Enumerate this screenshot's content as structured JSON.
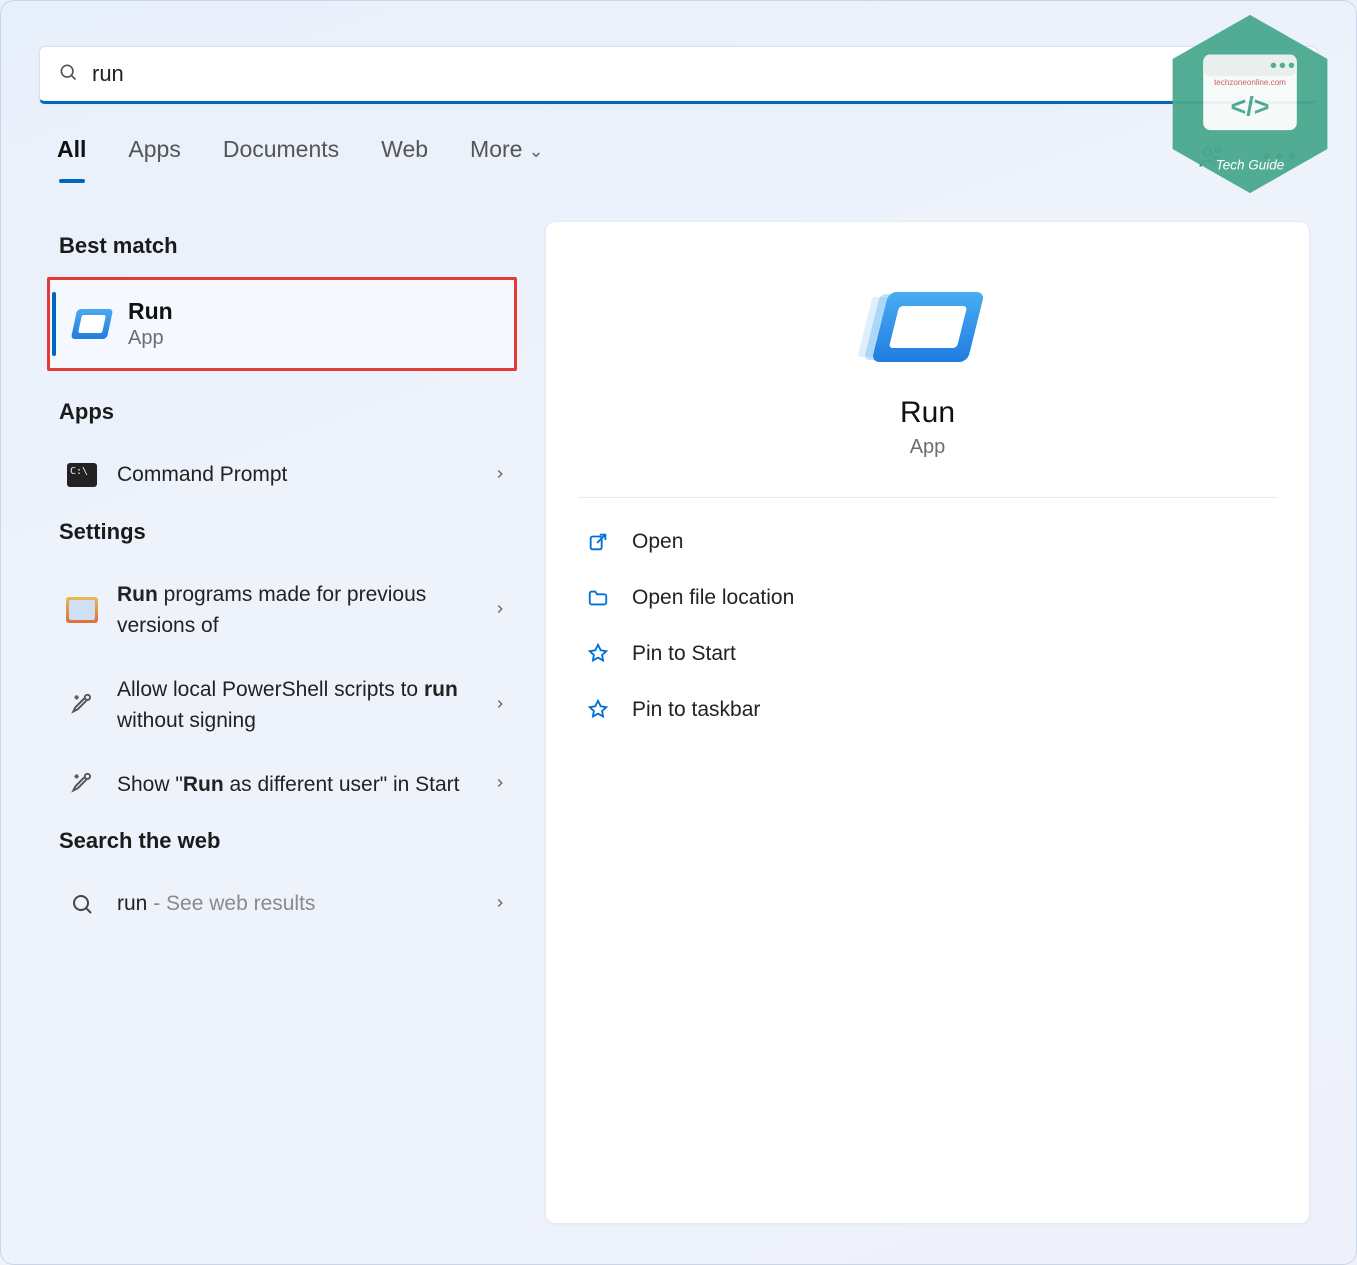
{
  "search": {
    "query": "run"
  },
  "tabs": {
    "items": [
      "All",
      "Apps",
      "Documents",
      "Web",
      "More"
    ],
    "active": 0
  },
  "left": {
    "best_match_heading": "Best match",
    "best_match": {
      "title": "Run",
      "subtitle": "App"
    },
    "apps_heading": "Apps",
    "apps": [
      {
        "label": "Command Prompt"
      }
    ],
    "settings_heading": "Settings",
    "settings": [
      {
        "pre": "",
        "bold": "Run",
        "post": " programs made for previous versions of"
      },
      {
        "pre": "Allow local PowerShell scripts to ",
        "bold": "run",
        "post": " without signing"
      },
      {
        "pre": "Show \"",
        "bold": "Run",
        "post": " as different user\" in Start"
      }
    ],
    "web_heading": "Search the web",
    "web": {
      "term": "run",
      "suffix": " - See web results"
    }
  },
  "right": {
    "title": "Run",
    "subtitle": "App",
    "actions": [
      "Open",
      "Open file location",
      "Pin to Start",
      "Pin to taskbar"
    ]
  },
  "watermark": {
    "line1": "techzoneonline.com",
    "line2": "Tech Guide"
  }
}
